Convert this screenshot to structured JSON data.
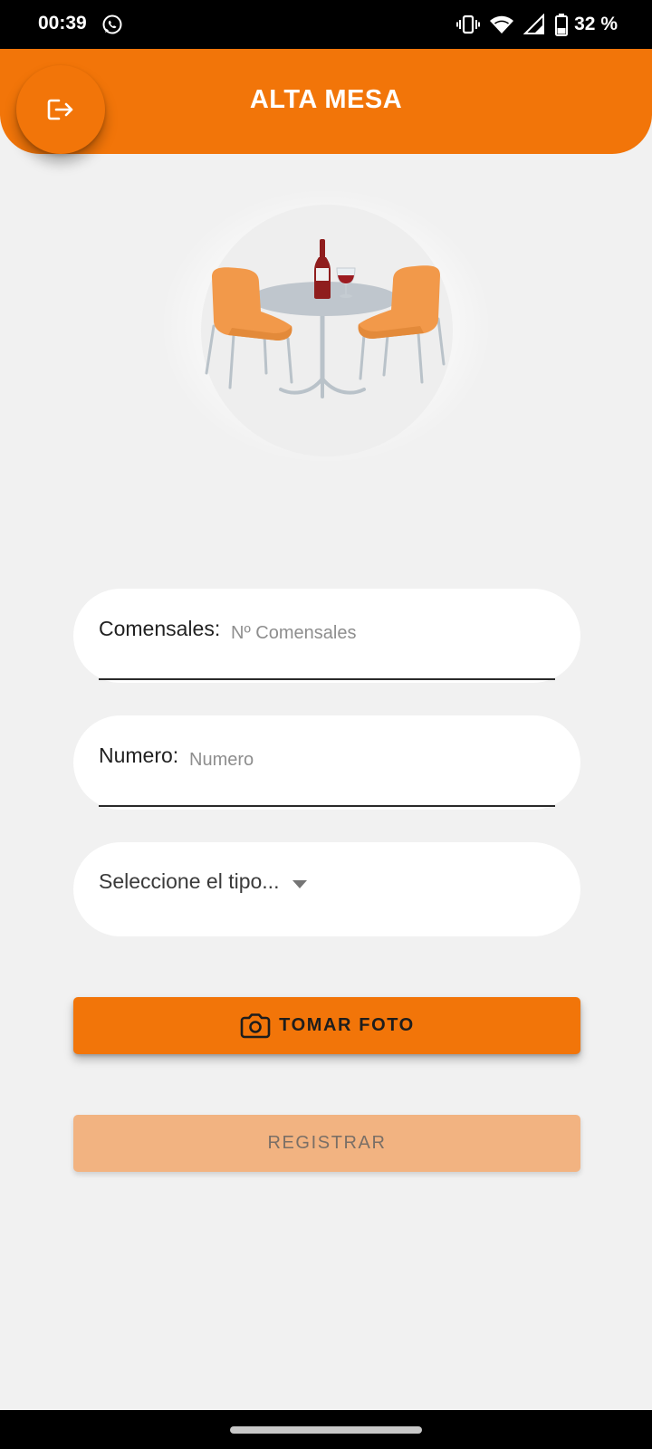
{
  "status_bar": {
    "time": "00:39",
    "notification_icon": "whatsapp-icon",
    "icons": [
      "vibrate-icon",
      "wifi-icon",
      "signal-icon",
      "battery-icon"
    ],
    "battery_percent": "32 %"
  },
  "header": {
    "title": "ALTA MESA",
    "logout_icon": "logout-icon"
  },
  "hero": {
    "image": "table-chairs-wine-illustration"
  },
  "form": {
    "comensales": {
      "label": "Comensales:",
      "placeholder": "Nº Comensales",
      "value": ""
    },
    "numero": {
      "label": "Numero:",
      "placeholder": "Numero",
      "value": ""
    },
    "tipo": {
      "selected": "Seleccione el tipo..."
    }
  },
  "buttons": {
    "take_photo": "TOMAR FOTO",
    "register": "REGISTRAR"
  },
  "colors": {
    "accent": "#f27509",
    "register_disabled": "#f2b381",
    "background": "#f1f1f1"
  }
}
